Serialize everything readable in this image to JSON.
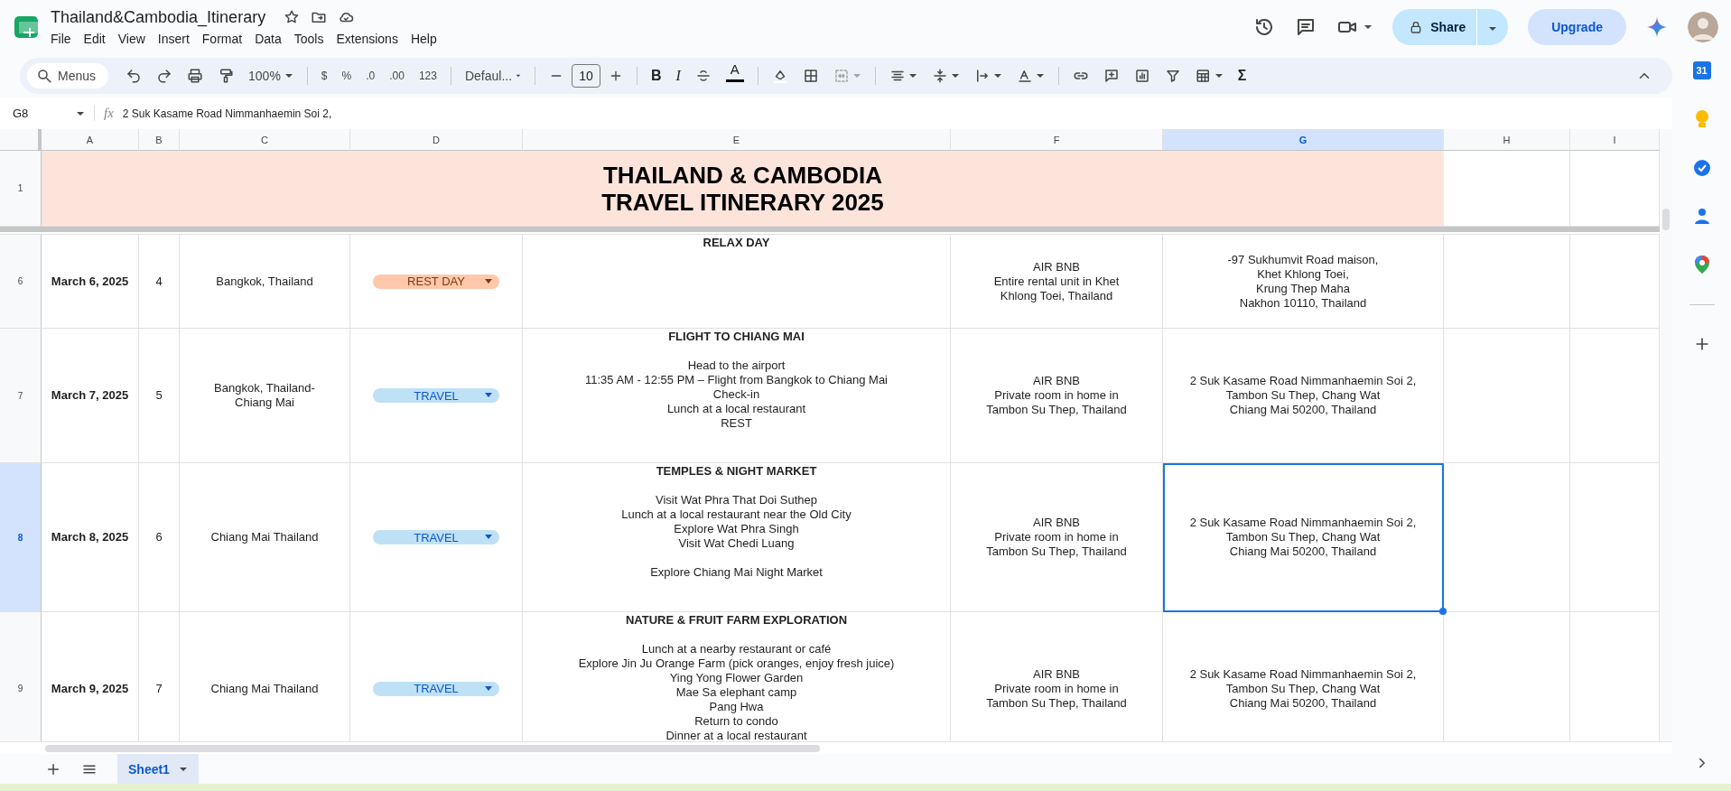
{
  "document": {
    "title": "Thailand&Cambodia_Itinerary"
  },
  "menu": [
    "File",
    "Edit",
    "View",
    "Insert",
    "Format",
    "Data",
    "Tools",
    "Extensions",
    "Help"
  ],
  "header_buttons": {
    "share": "Share",
    "upgrade": "Upgrade"
  },
  "toolbar": {
    "search_placeholder": "Menus",
    "zoom": "100%",
    "currency": "$",
    "percent": "%",
    "decrease_decimals": ".0",
    "increase_decimals": ".00",
    "number_format": "123",
    "font": "Defaul...",
    "font_size": "10",
    "bold": "B",
    "italic": "I",
    "text_color": "A",
    "merge_disabled": true,
    "sum": "Σ"
  },
  "formula_bar": {
    "cell": "G8",
    "fx": "fx",
    "content": "2 Suk Kasame Road Nimmanhaemin Soi 2,"
  },
  "columns": [
    {
      "label": "A",
      "selected": false
    },
    {
      "label": "B",
      "selected": false
    },
    {
      "label": "C",
      "selected": false
    },
    {
      "label": "D",
      "selected": false
    },
    {
      "label": "E",
      "selected": false
    },
    {
      "label": "F",
      "selected": false
    },
    {
      "label": "G",
      "selected": true
    },
    {
      "label": "H",
      "selected": false
    },
    {
      "label": "I",
      "selected": false
    }
  ],
  "title_row": {
    "number": "1",
    "selected": false,
    "title": "THAILAND & CAMBODIA\nTRAVEL ITINERARY 2025"
  },
  "rows": [
    {
      "number": "6",
      "selected": false,
      "date": "March 6, 2025",
      "day": "4",
      "location": "Bangkok, Thailand",
      "status": {
        "label": "REST DAY",
        "kind": "rest",
        "color": "#ffc8aa"
      },
      "plan": {
        "heading": "RELAX DAY"
      },
      "stay": "AIR BNB\nEntire rental unit in Khet\nKhlong Toei, Thailand",
      "address": "-97 Sukhumvit Road maison,\nKhet Khlong Toei,\nKrung Thep Maha\nNakhon 10110, Thailand"
    },
    {
      "number": "7",
      "selected": false,
      "date": "March 7, 2025",
      "day": "5",
      "location": "Bangkok, Thailand-\nChiang Mai",
      "status": {
        "label": "TRAVEL",
        "kind": "travel",
        "color": "#bfe1f6"
      },
      "plan": {
        "heading": "FLIGHT TO CHIANG MAI",
        "details": "Head to the airport\n11:35 AM - 12:55 PM – Flight from Bangkok to Chiang Mai\nCheck-in\nLunch at a local restaurant\nREST"
      },
      "stay": "AIR BNB\nPrivate room in home in\nTambon Su Thep, Thailand",
      "address": "2 Suk Kasame Road Nimmanhaemin Soi 2,\nTambon Su Thep, Chang Wat\nChiang Mai 50200, Thailand"
    },
    {
      "number": "8",
      "selected": true,
      "date": "March 8, 2025",
      "day": "6",
      "location": "Chiang Mai Thailand",
      "status": {
        "label": "TRAVEL",
        "kind": "travel",
        "color": "#bfe1f6"
      },
      "plan": {
        "heading": "TEMPLES & NIGHT MARKET",
        "details": "Visit Wat Phra That Doi Suthep\nLunch at a local restaurant near the Old City\nExplore Wat Phra Singh\nVisit Wat Chedi Luang\n\nExplore Chiang Mai Night Market"
      },
      "stay": "AIR BNB\nPrivate room in home in\nTambon Su Thep, Thailand",
      "address": "2 Suk Kasame Road Nimmanhaemin Soi 2,\nTambon Su Thep, Chang Wat\nChiang Mai 50200, Thailand"
    },
    {
      "number": "9",
      "selected": false,
      "date": "March 9, 2025",
      "day": "7",
      "location": "Chiang Mai Thailand",
      "status": {
        "label": "TRAVEL",
        "kind": "travel",
        "color": "#bfe1f6"
      },
      "plan": {
        "heading": "NATURE & FRUIT FARM EXPLORATION",
        "details": "Lunch at a nearby restaurant or café\nExplore Jin Ju Orange Farm (pick oranges, enjoy fresh juice)\nYing Yong Flower Garden\nMae Sa elephant camp\nPang Hwa\nReturn to condo\nDinner at a local restaurant"
      },
      "stay": "AIR BNB\nPrivate room in home in\nTambon Su Thep, Thailand",
      "address": "2 Suk Kasame Road Nimmanhaemin Soi 2,\nTambon Su Thep, Chang Wat\nChiang Mai 50200, Thailand"
    }
  ],
  "sheet_tabs": [
    {
      "label": "Sheet1",
      "selected": true
    }
  ],
  "side_panel": {
    "calendar_day": "31"
  }
}
